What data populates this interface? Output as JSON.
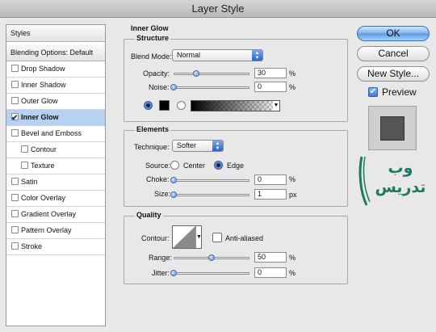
{
  "window": {
    "title": "Layer Style"
  },
  "sidebar": {
    "header": "Styles",
    "blending": "Blending Options: Default",
    "items": [
      {
        "label": "Drop Shadow",
        "checked": false,
        "selected": false,
        "indent": false
      },
      {
        "label": "Inner Shadow",
        "checked": false,
        "selected": false,
        "indent": false
      },
      {
        "label": "Outer Glow",
        "checked": false,
        "selected": false,
        "indent": false
      },
      {
        "label": "Inner Glow",
        "checked": true,
        "selected": true,
        "indent": false
      },
      {
        "label": "Bevel and Emboss",
        "checked": false,
        "selected": false,
        "indent": false
      },
      {
        "label": "Contour",
        "checked": false,
        "selected": false,
        "indent": true
      },
      {
        "label": "Texture",
        "checked": false,
        "selected": false,
        "indent": true
      },
      {
        "label": "Satin",
        "checked": false,
        "selected": false,
        "indent": false
      },
      {
        "label": "Color Overlay",
        "checked": false,
        "selected": false,
        "indent": false
      },
      {
        "label": "Gradient Overlay",
        "checked": false,
        "selected": false,
        "indent": false
      },
      {
        "label": "Pattern Overlay",
        "checked": false,
        "selected": false,
        "indent": false
      },
      {
        "label": "Stroke",
        "checked": false,
        "selected": false,
        "indent": false
      }
    ]
  },
  "panel": {
    "title": "Inner Glow",
    "structure": {
      "title": "Structure",
      "blend_mode_label": "Blend Mode:",
      "blend_mode_value": "Normal",
      "opacity_label": "Opacity:",
      "opacity_value": "30",
      "opacity_fraction": 0.3,
      "noise_label": "Noise:",
      "noise_value": "0",
      "noise_fraction": 0,
      "percent": "%"
    },
    "elements": {
      "title": "Elements",
      "technique_label": "Technique:",
      "technique_value": "Softer",
      "source_label": "Source:",
      "center_label": "Center",
      "edge_label": "Edge",
      "choke_label": "Choke:",
      "choke_value": "0",
      "size_label": "Size:",
      "size_value": "1",
      "px": "px",
      "percent": "%"
    },
    "quality": {
      "title": "Quality",
      "contour_label": "Contour:",
      "antialiased_label": "Anti-aliased",
      "range_label": "Range:",
      "range_value": "50",
      "range_fraction": 0.5,
      "jitter_label": "Jitter:",
      "jitter_value": "0",
      "percent": "%"
    }
  },
  "buttons": {
    "ok": "OK",
    "cancel": "Cancel",
    "new_style": "New Style...",
    "preview": "Preview"
  },
  "logo_text": "وب تدریس",
  "colors": {
    "accent": "#2e64c6",
    "selection": "#b7d2f1",
    "logo_green": "#1b7a63"
  }
}
